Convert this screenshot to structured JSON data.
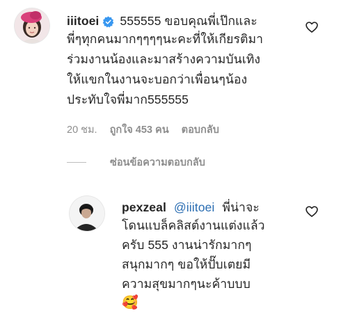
{
  "comment": {
    "username": "iiitoei",
    "verified": true,
    "lines": [
      "555555 ขอบคุณพี่เป๊กและ",
      "พี่ๆทุกคนมากๆๆๆๆนะคะที่ให้เกียรติมา",
      "ร่วมงานน้องและมาสร้างความบันเทิง",
      "ให้แขกในงานจะบอกว่าเพื่อนๆน้อง",
      "ประทับใจพี่มาก555555"
    ],
    "time": "20 ชม.",
    "likes": "ถูกใจ 453 คน",
    "reply_label": "ตอบกลับ",
    "hide_replies_label": "ซ่อนข้อความตอบกลับ"
  },
  "reply": {
    "username": "pexzeal",
    "mention": "@iiitoei",
    "first_line_rest": "พี่น่าจะ",
    "lines": [
      "โดนแบล็คลิสต์งานแต่งแล้ว",
      "ครับ 555 งานน่ารักมากๆ",
      "สนุกมากๆ ขอให้ปั๊บเตยมี",
      "ความสุขมากๆนะค้าบบบ"
    ],
    "emoji": "🥰"
  },
  "colors": {
    "text": "#262626",
    "meta": "#8e8e8e",
    "verified": "#3897f0",
    "mention": "#2a6db2"
  }
}
